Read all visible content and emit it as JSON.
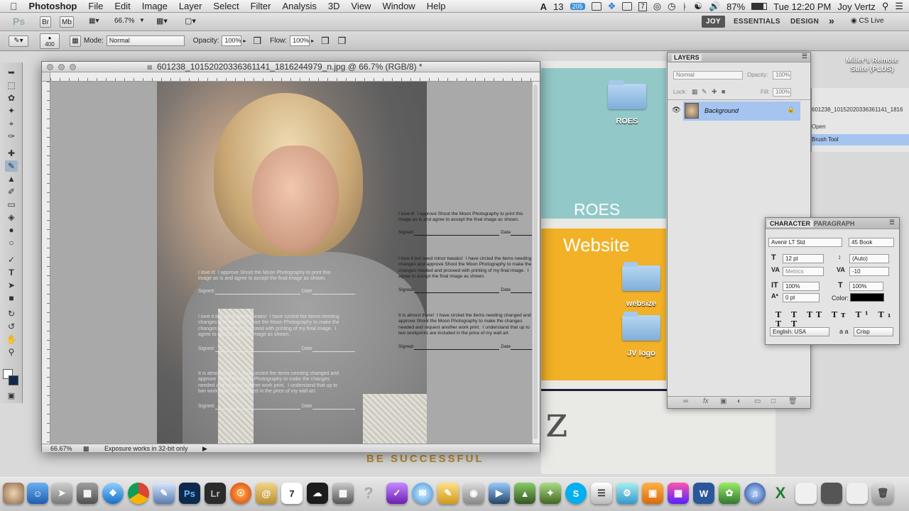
{
  "menubar": {
    "apple": "",
    "app_name": "Photoshop",
    "items": [
      "File",
      "Edit",
      "Image",
      "Layer",
      "Select",
      "Filter",
      "Analysis",
      "3D",
      "View",
      "Window",
      "Help"
    ],
    "status": {
      "adobe_count": "13",
      "badge": "205",
      "battery": "87%",
      "clock": "Tue 12:20 PM",
      "user": "Joy Vertz"
    }
  },
  "appbar": {
    "ps": "Ps",
    "br": "Br",
    "mb": "Mb",
    "zoom": "66.7%",
    "workspaces": [
      "JOY",
      "ESSENTIALS",
      "DESIGN"
    ],
    "more": "»",
    "cs_live": "CS Live"
  },
  "options": {
    "brush_size": "400",
    "mode_label": "Mode:",
    "mode_value": "Normal",
    "opacity_label": "Opacity:",
    "opacity_value": "100%",
    "flow_label": "Flow:",
    "flow_value": "100%"
  },
  "document": {
    "title": "601238_10152020336361141_1816244979_n.jpg @ 66.7% (RGB/8) *",
    "ruler_marks": [
      "0",
      "1",
      "2",
      "3",
      "4",
      "5",
      "6",
      "7",
      "8",
      "9",
      "10",
      "11",
      "12"
    ],
    "zoom": "66.67%",
    "status_text": "Exposure works in 32-bit only",
    "proof": {
      "block1": "I love it!  I approve Shoot the Moon Photography to print this\nimage as is and agree to accept the final image as shown.",
      "block2": "I love it but need minor tweaks!  I have circled the items needing\nchanges and approve Shoot the Moon Photography to make the\nchanges needed and proceed with printing of my final image.  I\nagree to accept the final image as shown.",
      "block3": "It is almost there!  I have circled the items needing changed and\napprove Shoot the Moon Photography to make the changes\nneeded and request another work print.  I understand that up to\ntwo workprints are included in the price of my wall art.",
      "signed": "Signed:",
      "date": "Date"
    }
  },
  "website": {
    "roes_folder": "ROES",
    "roes_big": "ROES",
    "website_big": "Website",
    "folder_websize": "websize",
    "folder_jv": "JV logo",
    "tagline": "BE SUCCESSFUL",
    "remote": "Miller's Remote\nSuite (PLUS)"
  },
  "layers": {
    "tab": "LAYERS",
    "blend": "Normal",
    "opacity_label": "Opacity:",
    "opacity": "100%",
    "lock_label": "Lock:",
    "fill_label": "Fill:",
    "fill": "100%",
    "layer_name": "Background"
  },
  "history": {
    "title": "601238_10152020336361141_1816",
    "items": [
      "Open",
      "Brush Tool"
    ]
  },
  "character": {
    "tabs": [
      "CHARACTER",
      "PARAGRAPH"
    ],
    "font": "Avenir LT Std",
    "style": "45 Book",
    "size": "12 pt",
    "leading": "(Auto)",
    "kerning": "Metrics",
    "tracking": "-10",
    "vscale": "100%",
    "hscale": "100%",
    "baseline": "0 pt",
    "color_label": "Color:",
    "language": "English: USA",
    "aa_label": "a a",
    "antialias": "Crisp"
  },
  "colors": {
    "layer_selected": "#a5c4f0",
    "teal": "#92c9c8",
    "orange": "#f2b126"
  }
}
